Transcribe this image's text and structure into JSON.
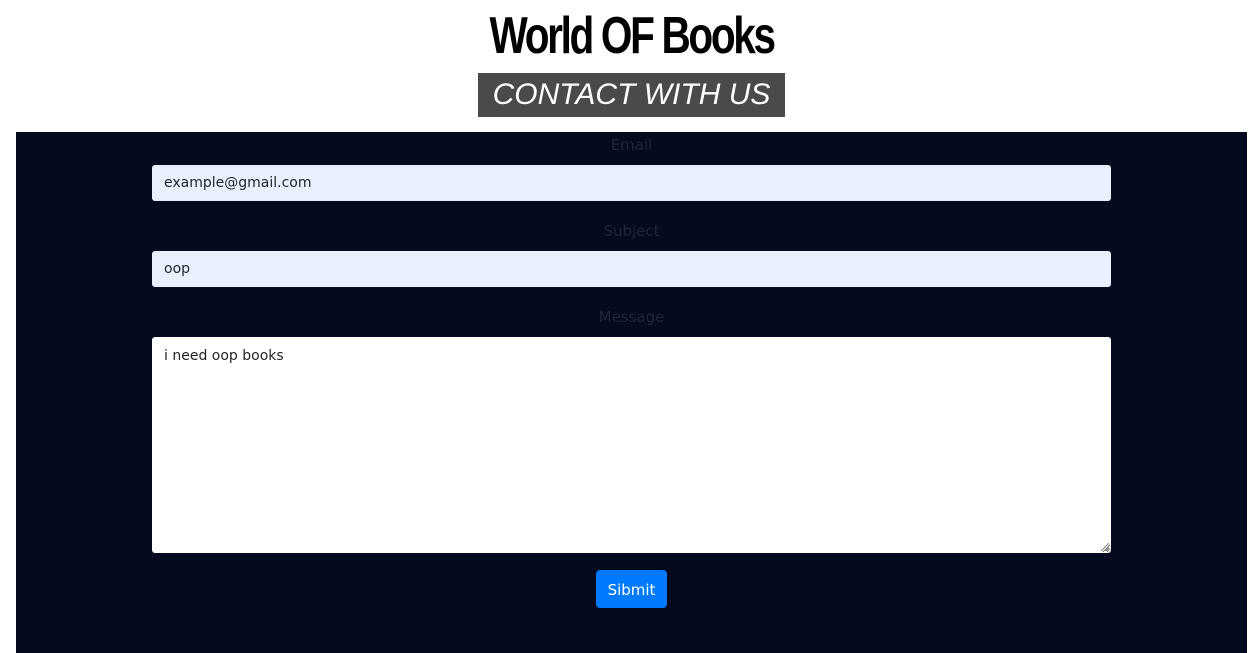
{
  "header": {
    "site_title": "World OF Books",
    "contact_banner": "CONTACT WITH US"
  },
  "form": {
    "email": {
      "label": "Email",
      "value": "example@gmail.com"
    },
    "subject": {
      "label": "Subject",
      "value": "oop"
    },
    "message": {
      "label": "Message",
      "value": "i need oop books"
    },
    "submit_label": "Sibmit"
  },
  "colors": {
    "panel_background": "#050a1e",
    "input_autofill_background": "#e8f0fe",
    "submit_button": "#007bff",
    "banner_background": "#4a4a4a"
  }
}
